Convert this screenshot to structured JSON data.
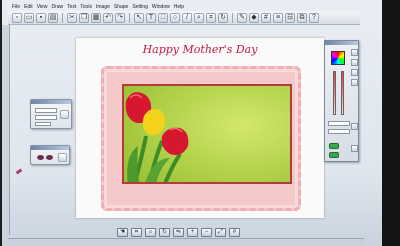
{
  "menubar": {
    "items": [
      "File",
      "Edit",
      "View",
      "Draw",
      "Text",
      "Tools",
      "Image",
      "Shape",
      "Setting",
      "Window",
      "Help"
    ]
  },
  "canvas": {
    "title": "Happy Mother's Day"
  },
  "colors": {
    "title_red": "#c0183d",
    "frame_pink": "#f5c9c9",
    "photo_green": "#b7d64a",
    "tulip_red": "#d6172f",
    "tulip_yellow": "#f2d21b"
  },
  "icons": {
    "toolbar": [
      "new",
      "open",
      "save",
      "print",
      "cut",
      "copy",
      "paste",
      "undo",
      "redo",
      "pointer",
      "text",
      "shape",
      "zoom",
      "crop"
    ],
    "bottom": [
      "hand",
      "crop",
      "brightness",
      "rotate",
      "flip",
      "zoom-in",
      "zoom-out",
      "fit"
    ]
  }
}
